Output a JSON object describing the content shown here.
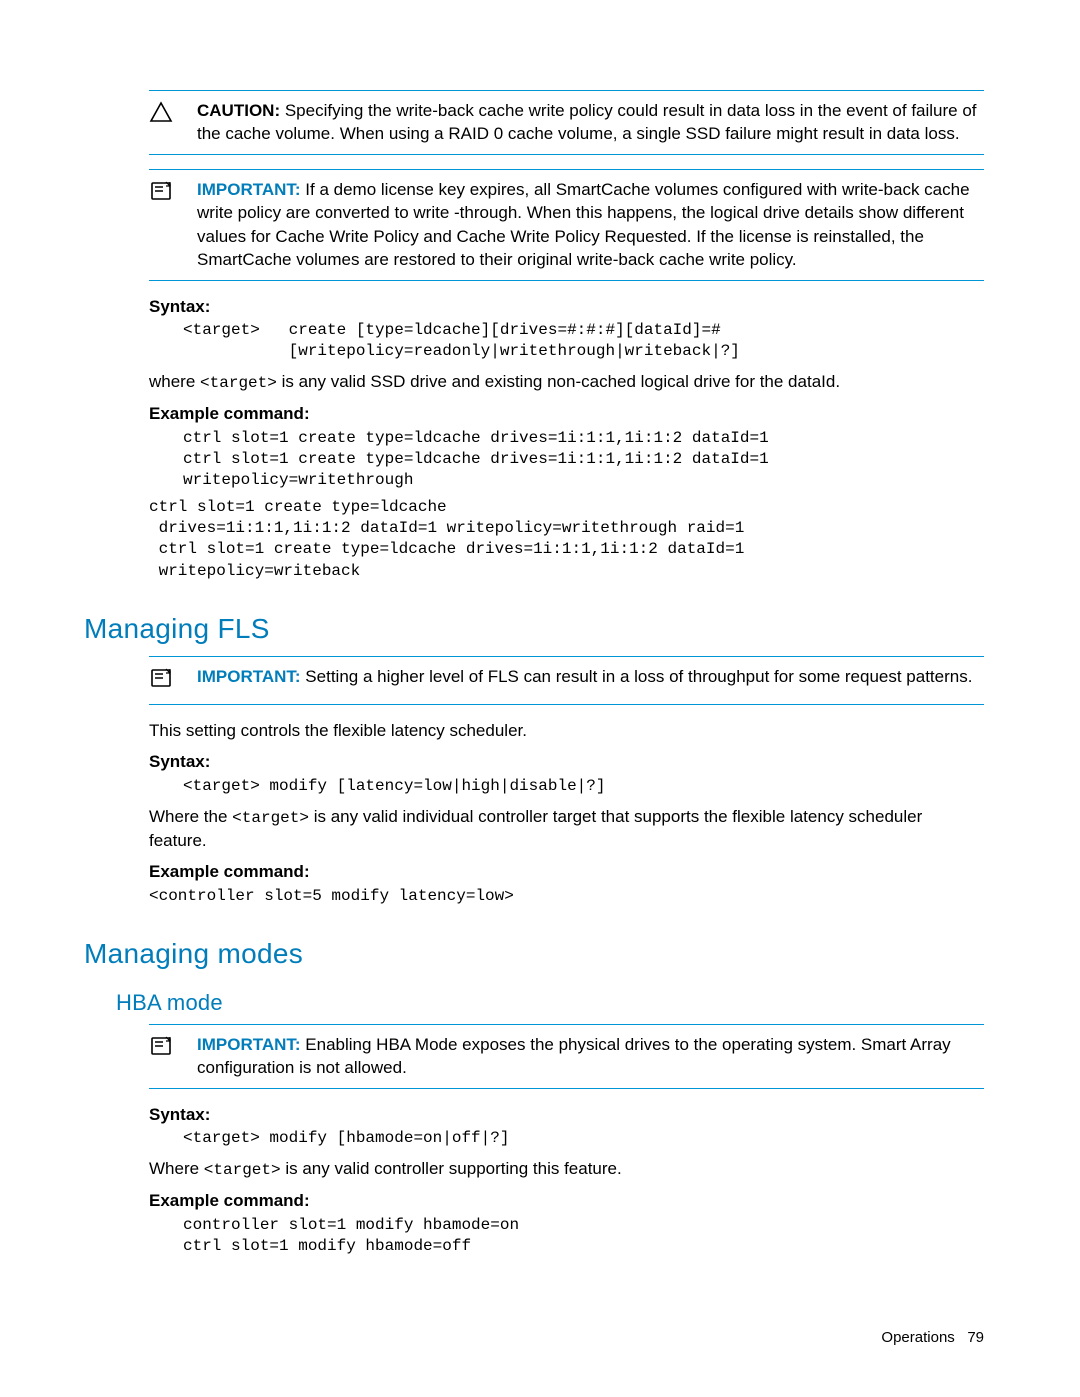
{
  "callouts": {
    "caution1": {
      "label": "CAUTION:",
      "text": "Specifying the write-back cache write policy could result in data loss in the event of failure of the cache volume. When using a RAID 0 cache volume, a single SSD failure might result in data loss."
    },
    "important1": {
      "label": "IMPORTANT:",
      "text": "If a demo license key expires, all SmartCache volumes configured with write-back cache write policy are converted to write -through. When this happens, the logical drive details show different values for Cache Write Policy and Cache Write Policy Requested. If the license is reinstalled, the SmartCache volumes are restored to their original write-back cache write policy."
    },
    "important2": {
      "label": "IMPORTANT:",
      "text": "Setting a higher level of FLS can result in a loss of throughput for some request patterns."
    },
    "important3": {
      "label": "IMPORTANT:",
      "text": "Enabling HBA Mode exposes the physical drives to the operating system. Smart Array configuration is not allowed."
    }
  },
  "labels": {
    "syntax": "Syntax:",
    "example": "Example command:"
  },
  "section1": {
    "syntax_code": "<target>   create [type=ldcache][drives=#:#:#][dataId]=#\n           [writepolicy=readonly|writethrough|writeback|?]",
    "where_pre": "where ",
    "where_code": "<target>",
    "where_post": " is any valid SSD drive and existing non-cached logical drive for the dataId.",
    "example_code": "ctrl slot=1 create type=ldcache drives=1i:1:1,1i:1:2 dataId=1\nctrl slot=1 create type=ldcache drives=1i:1:1,1i:1:2 dataId=1\nwritepolicy=writethrough",
    "example_code2": "ctrl slot=1 create type=ldcache\n drives=1i:1:1,1i:1:2 dataId=1 writepolicy=writethrough raid=1\n ctrl slot=1 create type=ldcache drives=1i:1:1,1i:1:2 dataId=1\n writepolicy=writeback"
  },
  "section2": {
    "heading": "Managing FLS",
    "intro": "This setting controls the flexible latency scheduler.",
    "syntax_code": "<target> modify [latency=low|high|disable|?]",
    "where_pre": "Where the ",
    "where_code": "<target>",
    "where_post": " is any valid individual controller target that supports the flexible latency scheduler feature.",
    "example_code": "<controller slot=5 modify latency=low>"
  },
  "section3": {
    "heading": "Managing modes",
    "sub_heading": "HBA mode",
    "syntax_code": "<target> modify [hbamode=on|off|?]",
    "where_pre": "Where ",
    "where_code": "<target>",
    "where_post": " is any valid controller supporting this feature.",
    "example_code": "controller slot=1 modify hbamode=on\nctrl slot=1 modify hbamode=off"
  },
  "footer": {
    "section": "Operations",
    "page": "79"
  }
}
